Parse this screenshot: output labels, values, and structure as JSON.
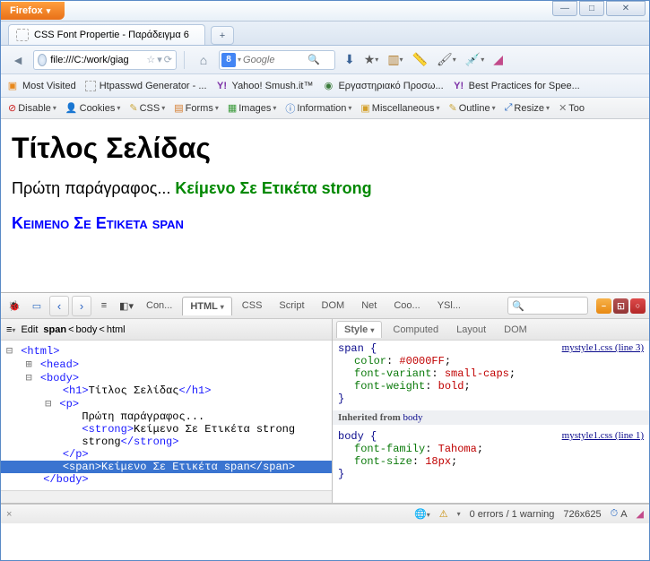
{
  "titlebar": {
    "firefox": "Firefox"
  },
  "tab": {
    "title": "CSS Font Propertie - Παράδειγμα 6"
  },
  "url": {
    "value": "file:///C:/work/giag"
  },
  "search": {
    "provider": "8",
    "placeholder": "Google"
  },
  "bookmarks": {
    "mostVisited": "Most Visited",
    "htpasswd": "Htpasswd Generator - ...",
    "smush": "Yahoo! Smush.it™",
    "lab": "Εργαστηριακό Προσω...",
    "best": "Best Practices for Spee..."
  },
  "wd": {
    "disable": "Disable",
    "cookies": "Cookies",
    "css": "CSS",
    "forms": "Forms",
    "images": "Images",
    "info": "Information",
    "misc": "Miscellaneous",
    "outline": "Outline",
    "resize": "Resize",
    "tools": "Too"
  },
  "page": {
    "h1": "Τίτλος Σελίδας",
    "p1a": "Πρώτη παράγραφος... ",
    "p1b": "Κείμενο Σε Ετικέτα strong",
    "p2": "Κειμενο Σε Ετικετα span"
  },
  "fbTop": {
    "console": "Con...",
    "html": "HTML",
    "css": "CSS",
    "script": "Script",
    "dom": "DOM",
    "net": "Net",
    "cookies": "Coo...",
    "yslow": "YSl..."
  },
  "crumbs": {
    "edit": "Edit",
    "c1": "span",
    "c2": "body",
    "c3": "html"
  },
  "tree": {
    "html_o": "<html>",
    "head": "<head>",
    "body_o": "<body>",
    "h1_o": "<h1>",
    "h1_t": "Τίτλος Σελίδας",
    "h1_c": "</h1>",
    "p_o": "<p>",
    "t1": "Πρώτη παράγραφος...",
    "strong_o": "<strong>",
    "strong_t": "Κείμενο Σε Ετικέτα strong",
    "strong_c": "</strong>",
    "p_c": "</p>",
    "span_o": "<span>",
    "span_t": "Κείμενο Σε Ετικέτα span",
    "span_c": "</span>",
    "body_c": "</body>"
  },
  "styleTabs": {
    "style": "Style",
    "computed": "Computed",
    "layout": "Layout",
    "dom": "DOM"
  },
  "rules": {
    "r1": {
      "sel": "span {",
      "src": "mystyle1.css (line 3)",
      "p1n": "color",
      "p1v": "#0000FF",
      "p2n": "font-variant",
      "p2v": "small-caps",
      "p3n": "font-weight",
      "p3v": "bold",
      "close": "}"
    },
    "inh": {
      "label": "Inherited from ",
      "src": "body"
    },
    "r2": {
      "sel": "body {",
      "src": "mystyle1.css (line 1)",
      "p1n": "font-family",
      "p1v": "Tahoma",
      "p2n": "font-size",
      "p2v": "18px",
      "close": "}"
    }
  },
  "status": {
    "errors": "0 errors / 1 warning",
    "dims": "726x625",
    "yslow": "A"
  }
}
